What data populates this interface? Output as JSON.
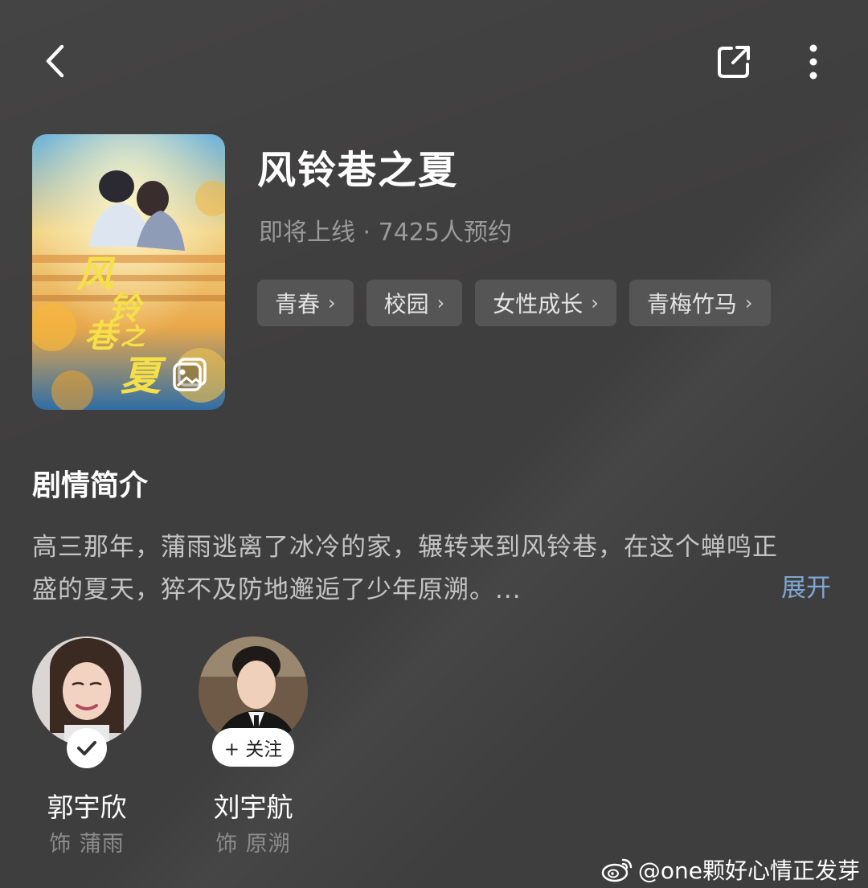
{
  "header": {
    "back_icon": "chevron-left-icon",
    "share_icon": "share-external-icon",
    "more_icon": "more-vertical-icon"
  },
  "show": {
    "title": "风铃巷之夏",
    "meta": "即将上线 · 7425人预约",
    "poster_text": "风铃巷之夏",
    "tags": [
      {
        "label": "青春"
      },
      {
        "label": "校园"
      },
      {
        "label": "女性成长"
      },
      {
        "label": "青梅竹马"
      }
    ]
  },
  "synopsis": {
    "heading": "剧情简介",
    "line1": "高三那年，蒲雨逃离了冰冷的家，辗转来到风铃巷，在这个蝉鸣正",
    "line2": "盛的夏天，猝不及防地邂逅了少年原溯。...",
    "expand_label": "展开"
  },
  "cast": [
    {
      "name": "郭宇欣",
      "role": "饰 蒲雨",
      "followed": true
    },
    {
      "name": "刘宇航",
      "role": "饰 原溯",
      "followed": false,
      "follow_label": "+ 关注"
    }
  ],
  "watermark": "@one颗好心情正发芽",
  "colors": {
    "background": "#3f3e3e",
    "tag_bg": "#565555",
    "link": "#7fa6d2",
    "muted": "#9a9a9a"
  }
}
